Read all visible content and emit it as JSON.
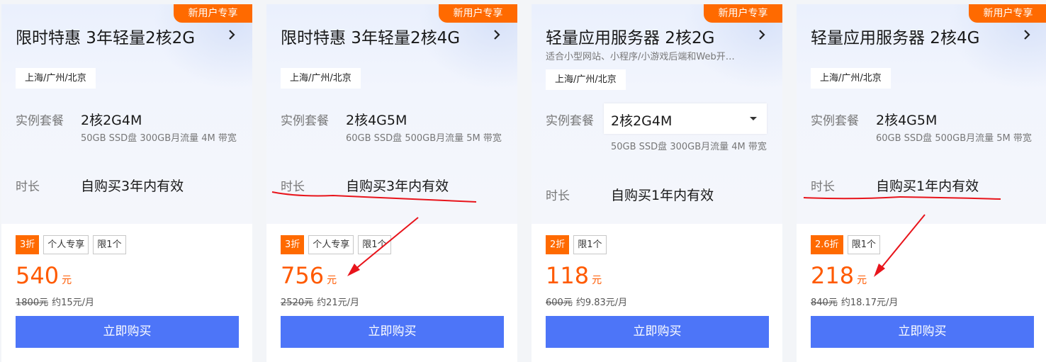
{
  "cards": [
    {
      "badge": "新用户专享",
      "title": "限时特惠 3年轻量2核2G",
      "subtitle": "",
      "region": "上海/广州/北京",
      "instance_label": "实例套餐",
      "instance_value": "2核2G4M",
      "instance_dropdown": false,
      "spec_desc": "50GB SSD盘 300GB月流量 4M 带宽",
      "duration_label": "时长",
      "duration_value": "自购买3年内有效",
      "tags": [
        "3折",
        "个人专享",
        "限1个"
      ],
      "price": "540",
      "price_unit": "元",
      "original_price": "1800元",
      "monthly": "约15元/月",
      "buy_label": "立即购买"
    },
    {
      "badge": "新用户专享",
      "title": "限时特惠 3年轻量2核4G",
      "subtitle": "",
      "region": "上海/广州/北京",
      "instance_label": "实例套餐",
      "instance_value": "2核4G5M",
      "instance_dropdown": false,
      "spec_desc": "60GB SSD盘 500GB月流量 5M 带宽",
      "duration_label": "时长",
      "duration_value": "自购买3年内有效",
      "tags": [
        "3折",
        "个人专享",
        "限1个"
      ],
      "price": "756",
      "price_unit": "元",
      "original_price": "2520元",
      "monthly": "约21元/月",
      "buy_label": "立即购买"
    },
    {
      "badge": "新用户专享",
      "title": "轻量应用服务器 2核2G",
      "subtitle": "适合小型网站、小程序/小游戏后端和Web开…",
      "region": "上海/广州/北京",
      "instance_label": "实例套餐",
      "instance_value": "2核2G4M",
      "instance_dropdown": true,
      "spec_desc": "50GB SSD盘 300GB月流量 4M 带宽",
      "duration_label": "时长",
      "duration_value": "自购买1年内有效",
      "tags": [
        "2折",
        "限1个"
      ],
      "price": "118",
      "price_unit": "元",
      "original_price": "600元",
      "monthly": "约9.83元/月",
      "buy_label": "立即购买"
    },
    {
      "badge": "新用户专享",
      "title": "轻量应用服务器 2核4G",
      "subtitle": "",
      "region": "上海/广州/北京",
      "instance_label": "实例套餐",
      "instance_value": "2核4G5M",
      "instance_dropdown": false,
      "spec_desc": "60GB SSD盘 500GB月流量 5M 带宽",
      "duration_label": "时长",
      "duration_value": "自购买1年内有效",
      "tags": [
        "2.6折",
        "限1个"
      ],
      "price": "218",
      "price_unit": "元",
      "original_price": "840元",
      "monthly": "约18.17元/月",
      "buy_label": "立即购买"
    }
  ],
  "colors": {
    "accent_orange": "#ff6a00",
    "price_orange": "#ff5a00",
    "button_blue": "#4d75f8",
    "annotation_red": "#e8141b"
  },
  "icons": {
    "title_arrow": "chevron-right-icon",
    "dropdown": "caret-down-icon"
  }
}
